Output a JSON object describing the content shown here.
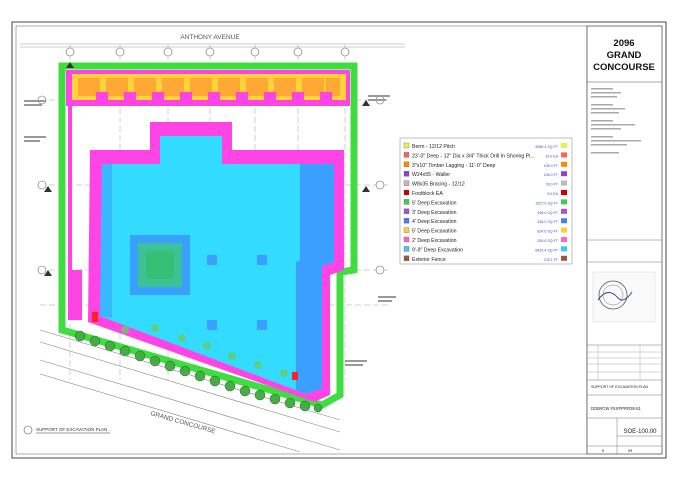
{
  "drawing": {
    "street_top": "ANTHONY AVENUE",
    "street_bottom": "GRAND CONCOURSE",
    "plan_title": "SUPPORT OF EXCAVATION PLAN"
  },
  "legend": {
    "items": [
      {
        "label": "Berm - 12/12 Pitch",
        "qty": "5066.4 SQ FT",
        "color": "#e8f04a"
      },
      {
        "label": "23'-0\" Deep - 12\" Dia x 3/4\" Thick Drill In Shoring Pi...",
        "qty": "19.0 EA",
        "color": "#ff6060"
      },
      {
        "label": "3\"x10\" Timber Lagging - 11'-0\" Deep",
        "qty": "106.0 FT",
        "color": "#ff8a00"
      },
      {
        "label": "W24x55 - Waller",
        "qty": "106.0 FT",
        "color": "#8844cc"
      },
      {
        "label": "W8x35 Bracing - 12/12",
        "qty": "78.0 FT",
        "color": "#bbbbbb"
      },
      {
        "label": "Footblock EA",
        "qty": "9.0 EA",
        "color": "#cc0000"
      },
      {
        "label": "5' Deep Excavation",
        "qty": "1527.0 SQ FT",
        "color": "#3ad14a"
      },
      {
        "label": "3' Deep Excavation",
        "qty": "106.0 SQ FT",
        "color": "#b04cd8"
      },
      {
        "label": "4' Deep Excavation",
        "qty": "328.0 SQ FT",
        "color": "#4a7cff"
      },
      {
        "label": "5' Deep Excavation",
        "qty": "824.6 SQ FT",
        "color": "#ffcc33"
      },
      {
        "label": "2' Deep Excavation",
        "qty": "255.6 SQ FT",
        "color": "#ff66cc"
      },
      {
        "label": "9'-9\" Deep Excavation",
        "qty": "6420.4 SQ FT",
        "color": "#33ccff"
      },
      {
        "label": "Exterior Fence",
        "qty": "278.1 FT",
        "color": "#9b5a3a"
      }
    ]
  },
  "titleblock": {
    "project_line1": "2096",
    "project_line2": "GRAND",
    "project_line3": "CONCOURSE",
    "sheet_title": "SUPPORT OF EXCAVATION PLAN",
    "drawing_code": "DOB#CW #XXPPRR28-51",
    "sheet_number": "SOE-100.00",
    "page_current": "5",
    "page_total": "09"
  },
  "colors": {
    "magenta": "#ff44e6",
    "cyan": "#33dcff",
    "blue": "#3aa0ff",
    "green": "#40dd40",
    "yellow": "#ffd23a"
  }
}
